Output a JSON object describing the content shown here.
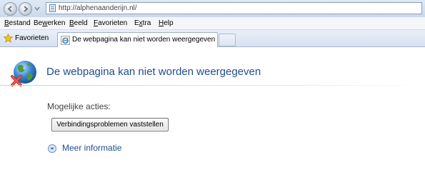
{
  "address_bar": {
    "url": "http://alphenaanderijn.nl/"
  },
  "menu": {
    "items": [
      {
        "accel": "B",
        "rest": "estand"
      },
      {
        "accel": "",
        "pre": "Be",
        "accel2": "w",
        "rest": "erken"
      },
      {
        "accel": "B",
        "rest": "eeld"
      },
      {
        "accel": "F",
        "rest": "avorieten"
      },
      {
        "accel": "",
        "pre": "E",
        "accel2": "x",
        "rest": "tra"
      },
      {
        "accel": "H",
        "rest": "elp"
      }
    ]
  },
  "favorites": {
    "label": "Favorieten"
  },
  "tab": {
    "title": "De webpagina kan niet worden weergegeven"
  },
  "content": {
    "heading": "De webpagina kan niet worden weergegeven",
    "actions_label": "Mogelijke acties:",
    "diagnose_button": "Verbindingsproblemen vaststellen",
    "more_info": "Meer informatie"
  },
  "icons": {
    "back": "back-arrow-icon",
    "forward": "forward-arrow-icon",
    "page": "page-icon",
    "star": "star-icon",
    "ie_tab": "ie-icon",
    "globe_error": "globe-error-icon",
    "expand": "expand-circle-icon"
  },
  "colors": {
    "heading": "#1f4d8f",
    "link": "#1f4d8f"
  }
}
